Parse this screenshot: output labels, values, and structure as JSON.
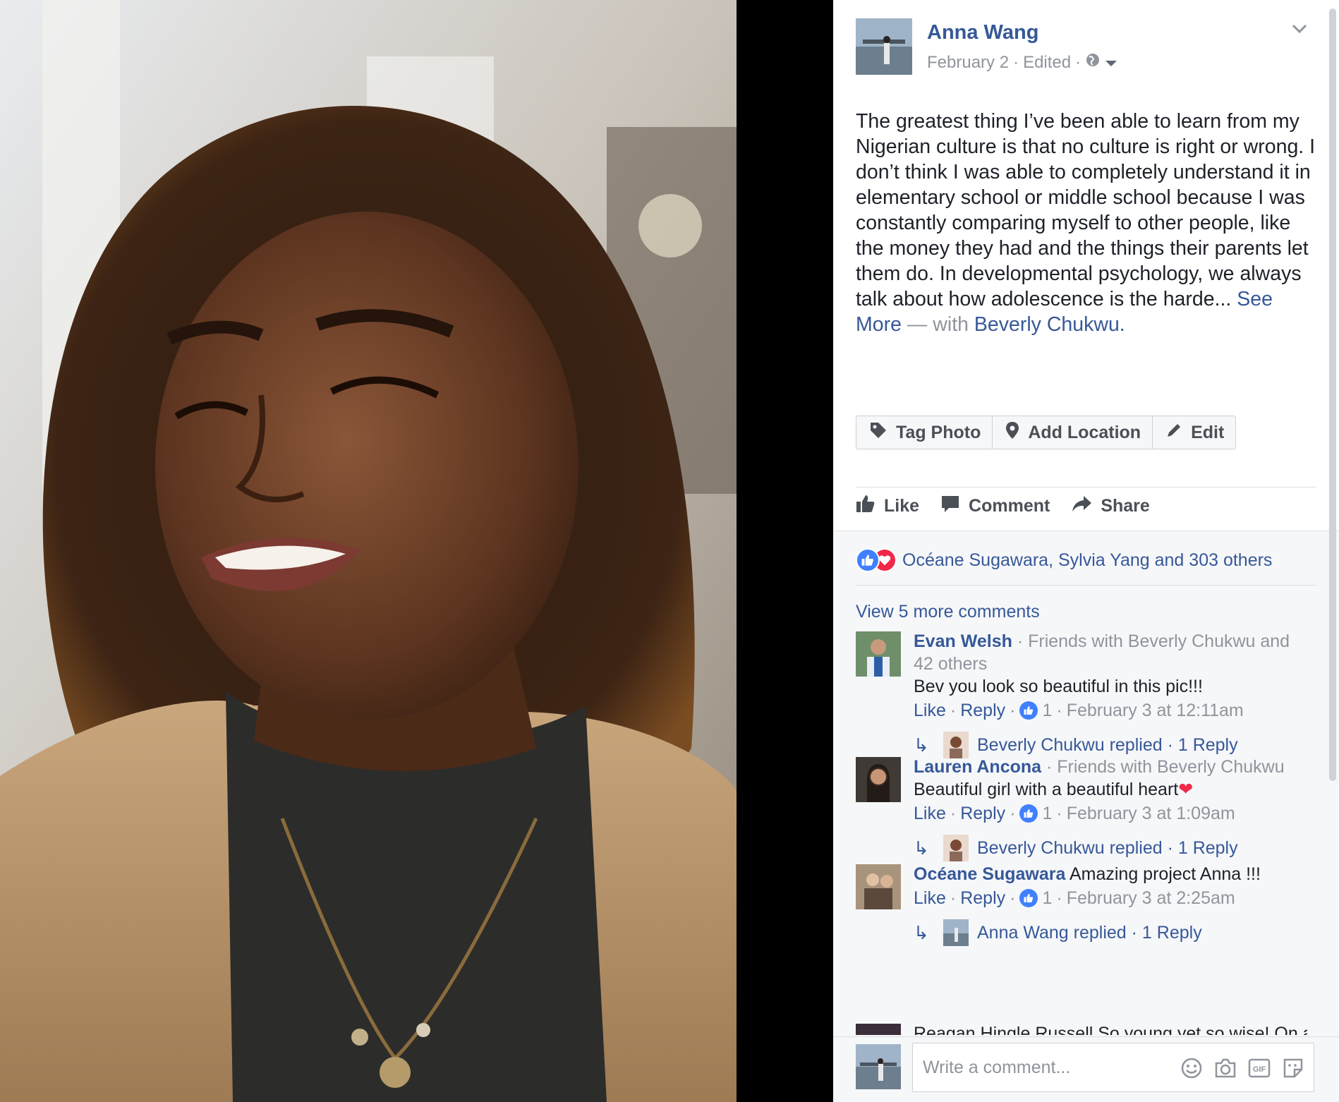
{
  "post": {
    "author": "Anna Wang",
    "date": "February 2",
    "edited": "Edited",
    "text": "The greatest thing I’ve been able to learn from my Nigerian culture is that no culture is right or wrong. I don’t think I was able to completely understand it in elementary school or middle school because I was constantly comparing myself to other people, like the money they had and the things their parents let them do. In developmental psychology, we always talk about how adolescence is the harde...",
    "see_more": "See More",
    "with_prefix": "— with",
    "tagged": "Beverly Chukwu."
  },
  "buttons": {
    "tag_photo": "Tag Photo",
    "add_location": "Add Location",
    "edit": "Edit"
  },
  "actions": {
    "like": "Like",
    "comment": "Comment",
    "share": "Share"
  },
  "reactions": {
    "summary": "Océane Sugawara, Sylvia Yang and 303 others"
  },
  "comments_section": {
    "view_more": "View 5 more comments",
    "comments": [
      {
        "name": "Evan Welsh",
        "sub": " · Friends with Beverly Chukwu and 42 others",
        "text": "Bev you look so beautiful in this pic!!!",
        "like": "Like",
        "reply": "Reply",
        "likes": "1",
        "time": "February 3 at 12:11am",
        "replied": "Beverly Chukwu replied · 1 Reply"
      },
      {
        "name": "Lauren Ancona",
        "sub": " · Friends with Beverly Chukwu",
        "text": "Beautiful girl with a beautiful heart",
        "like": "Like",
        "reply": "Reply",
        "likes": "1",
        "time": "February 3 at 1:09am",
        "replied": "Beverly Chukwu replied · 1 Reply"
      },
      {
        "name": "Océane Sugawara",
        "sub": "",
        "text": "Amazing project Anna !!!",
        "like": "Like",
        "reply": "Reply",
        "likes": "1",
        "time": "February 3 at 2:25am",
        "replied": "Anna Wang replied · 1 Reply"
      }
    ],
    "cut_off": "Reagan Hingle Russell So young yet so wise! On a"
  },
  "composer": {
    "placeholder": "Write a comment..."
  },
  "icons": {
    "audience": "globe-icon",
    "options": "chevron-down-icon",
    "tag": "tag-icon",
    "location": "pin-icon",
    "edit": "pencil-icon",
    "like": "thumbs-up-icon",
    "comment": "speech-bubble-icon",
    "share": "share-arrow-icon",
    "emoji": "smiley-icon",
    "camera": "camera-icon",
    "gif": "gif-icon",
    "sticker": "sticker-icon"
  },
  "colors": {
    "link": "#365899",
    "muted": "#90949c",
    "like_blue": "#4080ff",
    "love_red": "#f0284a"
  }
}
